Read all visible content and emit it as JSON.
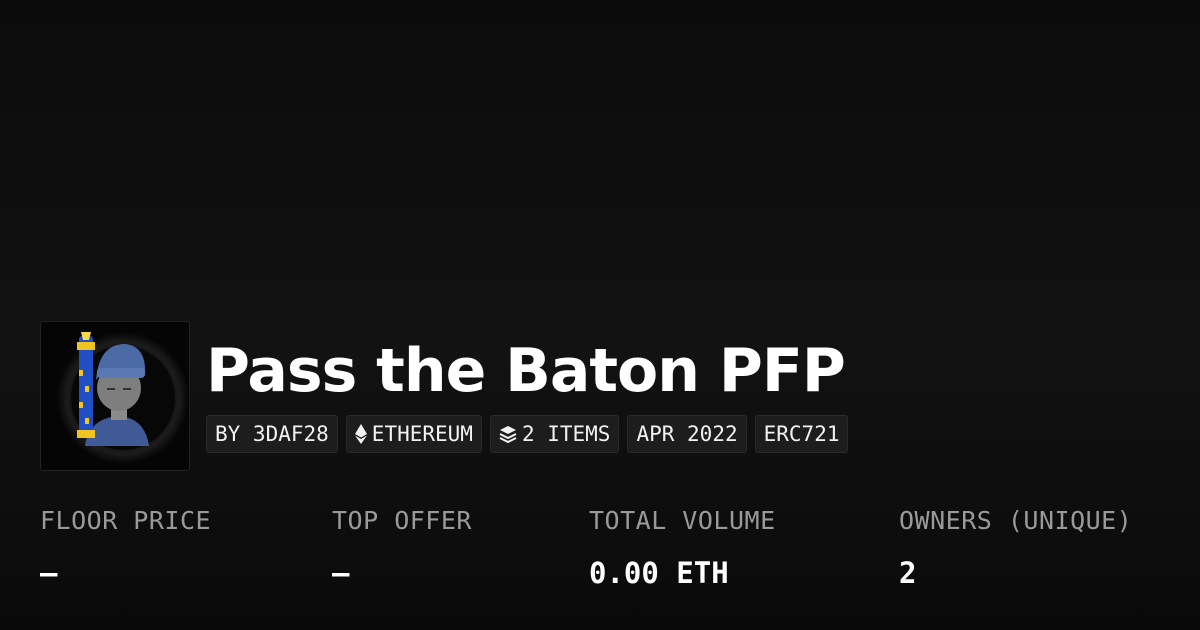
{
  "collection": {
    "title": "Pass the Baton PFP",
    "chips": {
      "creator": "BY 3DAF28",
      "chain": "ETHEREUM",
      "items": "2 ITEMS",
      "date": "APR 2022",
      "standard": "ERC721"
    },
    "icons": {
      "chain": "ethereum-icon",
      "items": "layers-icon",
      "avatar": "baton-avatar-image"
    }
  },
  "stats": {
    "floor_price": {
      "label": "FLOOR PRICE",
      "value": "–"
    },
    "top_offer": {
      "label": "TOP OFFER",
      "value": "–"
    },
    "total_volume": {
      "label": "TOTAL VOLUME",
      "value": "0.00 ETH"
    },
    "owners": {
      "label": "OWNERS (UNIQUE)",
      "value": "2"
    }
  },
  "colors": {
    "background": "#0b0b0b",
    "chip_background": "#1d1d1d",
    "label": "#9a9a9a",
    "text": "#ffffff"
  }
}
